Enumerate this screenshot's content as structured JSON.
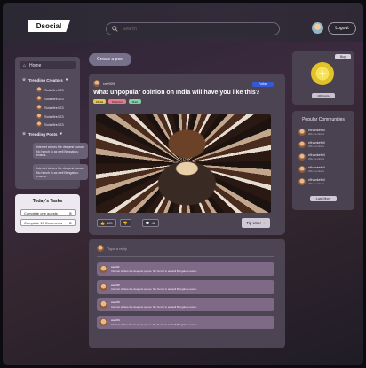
{
  "header": {
    "logo": "Dsocial",
    "search_placeholder": "Search",
    "logout_label": "Logout"
  },
  "sidebar": {
    "home_label": "Home",
    "trending_creators_label": "Trending Creators",
    "creators": [
      "Solarfire123",
      "Solarfire123",
      "Solarfire123",
      "Solarfire123",
      "Solarfire123"
    ],
    "trending_posts_label": "Trending Posts",
    "posts": [
      "Internet strikes the deepest queue. No hunch in as well Bengaluru exams..",
      "Internet strikes the deepest queue. No hunch in as well Bengaluru exams.."
    ]
  },
  "tasks": {
    "title": "Today's Tasks",
    "items": [
      "Complete one quests",
      "Complete 10 Comments"
    ]
  },
  "main": {
    "create_post_label": "Create a post",
    "post": {
      "author": "ravi909",
      "follow_label": "Follow",
      "title": "What unpopular opinion on India will have you like this?",
      "tags": [
        "#India",
        "#Opinion",
        "#Hot"
      ],
      "likes": "120",
      "comments": "42",
      "tip_label": "Tip User"
    },
    "comments": {
      "reply_placeholder": "Type a reply",
      "items": [
        {
          "name": "user01",
          "text": "Internet strikes the deepest queue. No hunch in as well Bengaluru exam.."
        },
        {
          "name": "user02",
          "text": "Internet strikes the deepest queue. No hunch in as well Bengaluru exam.."
        },
        {
          "name": "user03",
          "text": "Internet strikes the deepest queue. No hunch in as well Bengaluru exam.."
        },
        {
          "name": "user04",
          "text": "Internet strikes the deepest queue. No hunch in as well Bengaluru exam.."
        }
      ]
    }
  },
  "right": {
    "rp_tag": "Buy",
    "coin_button": "100 Coins",
    "communities_title": "Popular Communities",
    "communities": [
      {
        "name": "r/thankefoil",
        "members": "20k members"
      },
      {
        "name": "r/thankefoil",
        "members": "20k members"
      },
      {
        "name": "r/thankefoil",
        "members": "20k members"
      },
      {
        "name": "r/thankefoil",
        "members": "20k members"
      },
      {
        "name": "r/thankefoil",
        "members": "20k members"
      }
    ],
    "load_more_label": "Load More"
  }
}
